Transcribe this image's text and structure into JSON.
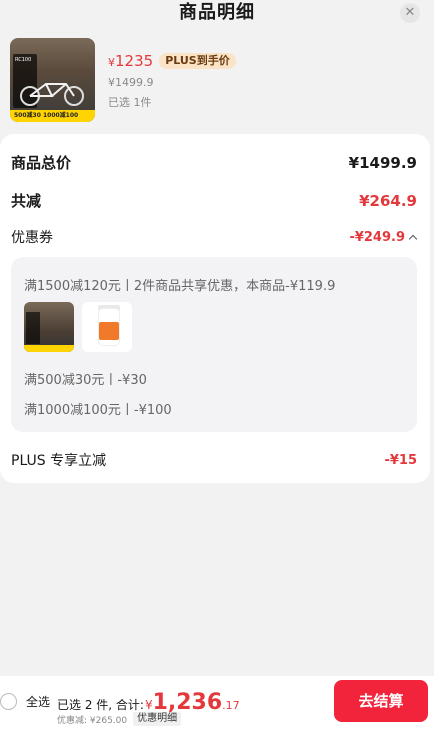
{
  "header": {
    "title": "商品明细",
    "close_icon": "close-icon"
  },
  "product": {
    "thumb_panel_text": "RC100",
    "thumb_strip_text": "500减30 1000减100",
    "price_yen": "¥",
    "price_value": "1235",
    "plus_tag": "PLUS到手价",
    "original_price": "¥1499.9",
    "selected_count": "已选 1件"
  },
  "summary": {
    "total_label": "商品总价",
    "total_value": "¥1499.9",
    "reduce_label": "共减",
    "reduce_value": "¥264.9",
    "coupon_label": "优惠券",
    "coupon_value": "-¥249.9",
    "coupon_desc": "满1500减120元丨2件商品共享优惠，本商品-¥119.9",
    "coupon_line1": "满500减30元丨-¥30",
    "coupon_line2": "满1000减100元丨-¥100",
    "plus_label": "PLUS 专享立减",
    "plus_value": "-¥15"
  },
  "bottom": {
    "select_all": "全选",
    "selected_sum_label": "已选 2 件, 合计:",
    "sum_yen": "¥",
    "sum_big": "1,236",
    "sum_decimal": ".17",
    "savings": "优惠减: ¥265.00",
    "detail_tag": "优惠明细",
    "checkout": "去结算"
  },
  "colors": {
    "accent_red": "#e4393c",
    "button_red": "#f2243b",
    "plus_bg": "#fbe3c8"
  }
}
